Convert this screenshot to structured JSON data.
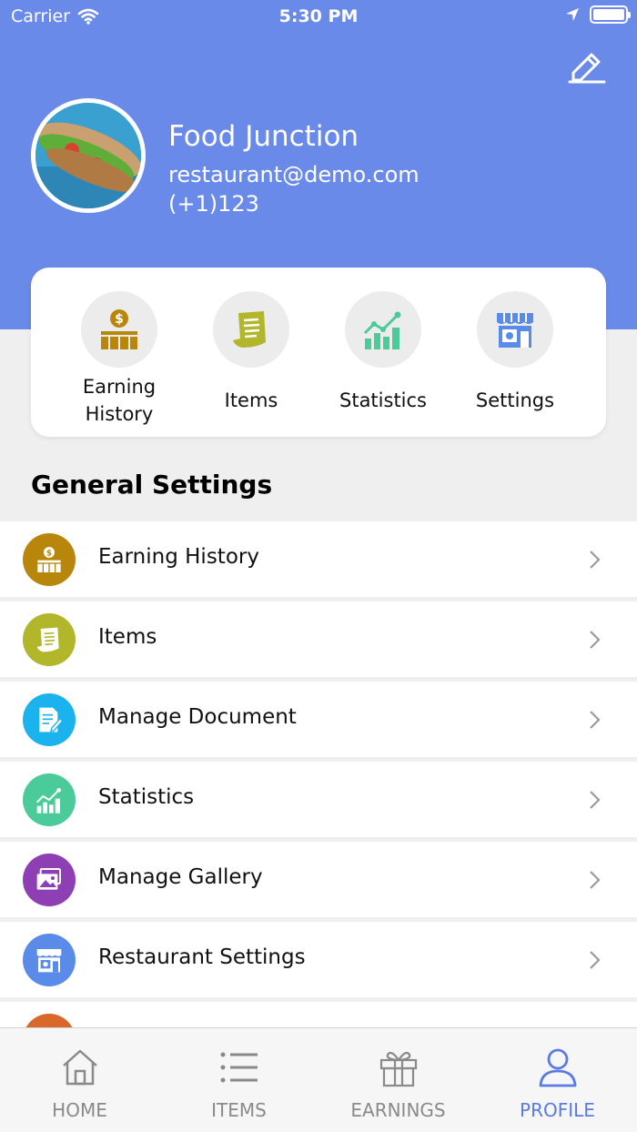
{
  "status_bar": {
    "carrier": "Carrier",
    "time": "5:30 PM"
  },
  "profile": {
    "name": "Food Junction",
    "email": "restaurant@demo.com",
    "phone": "(+1)123"
  },
  "quick_actions": [
    {
      "label": "Earning History",
      "icon": "earning-history-icon"
    },
    {
      "label": "Items",
      "icon": "items-icon"
    },
    {
      "label": "Statistics",
      "icon": "statistics-icon"
    },
    {
      "label": "Settings",
      "icon": "store-settings-icon"
    }
  ],
  "general_settings": {
    "title": "General Settings",
    "items": [
      {
        "label": "Earning History",
        "icon": "earning-history-icon",
        "color": "#b8860b"
      },
      {
        "label": "Items",
        "icon": "items-icon",
        "color": "#b2b62a"
      },
      {
        "label": "Manage Document",
        "icon": "document-icon",
        "color": "#1ab3ee"
      },
      {
        "label": "Statistics",
        "icon": "statistics-icon",
        "color": "#4ccb9a"
      },
      {
        "label": "Manage Gallery",
        "icon": "gallery-icon",
        "color": "#8e3fb3"
      },
      {
        "label": "Restaurant Settings",
        "icon": "store-settings-icon",
        "color": "#5a8be8"
      }
    ]
  },
  "tab_bar": {
    "tabs": [
      {
        "label": "HOME",
        "icon": "home-icon"
      },
      {
        "label": "ITEMS",
        "icon": "list-icon"
      },
      {
        "label": "EARNINGS",
        "icon": "gift-icon"
      },
      {
        "label": "PROFILE",
        "icon": "user-icon",
        "active": true
      }
    ]
  },
  "colors": {
    "header": "#6a8ae9",
    "accent": "#5a7be6"
  }
}
